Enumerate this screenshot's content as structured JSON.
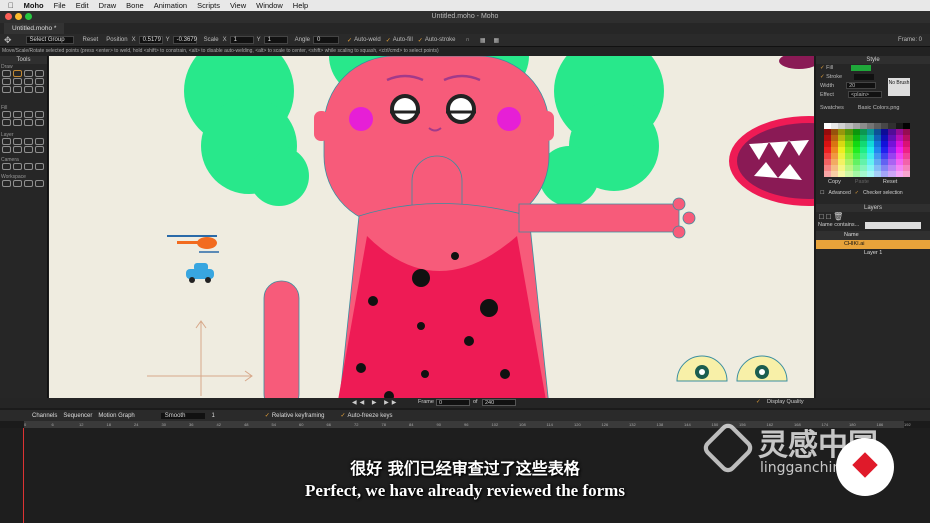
{
  "menubar": {
    "app": "Moho",
    "items": [
      "File",
      "Edit",
      "Draw",
      "Bone",
      "Animation",
      "Scripts",
      "View",
      "Window",
      "Help"
    ]
  },
  "window": {
    "title": "Untitled.moho - Moho",
    "tab": "Untitled.moho *"
  },
  "tool_options": {
    "mode": "Select Group",
    "reset": "Reset",
    "position_label": "Position",
    "x_label": "X",
    "x_value": "0.5179",
    "y_label": "Y",
    "y_value": "-0.3679",
    "scale_label": "Scale",
    "scale_x_label": "X",
    "scale_x": "1",
    "scale_y_label": "Y",
    "scale_y": "1",
    "angle_label": "Angle",
    "angle_value": "0",
    "auto_weld": "Auto-weld",
    "auto_fill": "Auto-fill",
    "auto_stroke": "Auto-stroke",
    "frame": "Frame: 0"
  },
  "hint": "Move/Scale/Rotate selected points (press <enter> to weld, hold <shift> to constrain, <alt> to disable auto-welding, <alt> to scale to center, <shift> while scaling to squash, <ctrl/cmd> to select points)",
  "tools": {
    "title": "Tools",
    "groups": [
      "Draw",
      "Fill",
      "Layer",
      "Camera",
      "Workspace"
    ]
  },
  "style": {
    "title": "Style",
    "fill": "Fill",
    "stroke": "Stroke",
    "width_label": "Width",
    "width": "20",
    "effect_label": "Effect",
    "effect": "<plain>",
    "no_brush": "No Brush",
    "swatches_label": "Swatches",
    "swatches_file": "Basic Colors.png",
    "copy": "Copy",
    "paste": "Paste",
    "reset": "Reset",
    "advanced": "Advanced",
    "checker": "Checker selection",
    "fill_color": "#1fa83a"
  },
  "layers": {
    "title": "Layers",
    "filter": "Name contains...",
    "col_name": "Name",
    "items": [
      "CHIKI.ai",
      "Layer 1"
    ]
  },
  "timeline": {
    "frame_label": "Frame",
    "frame": "0",
    "of": "of",
    "end": "240",
    "display_quality": "Display Quality",
    "tabs": [
      "Channels",
      "Sequencer",
      "Motion Graph"
    ],
    "interp": "Smooth",
    "step": "1",
    "relative_kf": "Relative keyframing",
    "auto_freeze": "Auto-freeze keys",
    "ticks": [
      "0",
      "6",
      "12",
      "18",
      "24",
      "30",
      "36",
      "42",
      "48",
      "54",
      "60",
      "66",
      "72",
      "78",
      "84",
      "90",
      "96",
      "102",
      "108",
      "114",
      "120",
      "126",
      "132",
      "138",
      "144",
      "150",
      "156",
      "162",
      "168",
      "174",
      "180",
      "186",
      "192"
    ]
  },
  "subtitles": {
    "zh": "很好 我们已经审查过了这些表格",
    "en": "Perfect, we have already reviewed the forms"
  },
  "watermark": {
    "cn": "灵感中国",
    "url": "lingganchina.com"
  }
}
